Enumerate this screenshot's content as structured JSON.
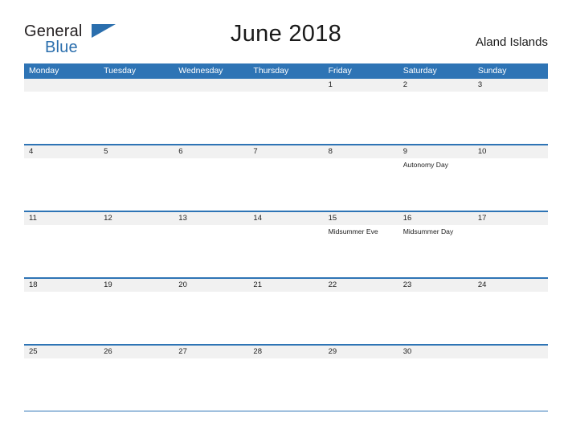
{
  "logo": {
    "text_general": "General",
    "text_blue": "Blue",
    "flag_icon": "blue-flag-icon"
  },
  "header": {
    "title": "June 2018",
    "region": "Aland Islands"
  },
  "colors": {
    "header_blue": "#2e74b5",
    "daynum_band": "#f1f1f1",
    "logo_blue": "#2a6ead",
    "text": "#222222"
  },
  "calendar": {
    "weekday_headers": [
      "Monday",
      "Tuesday",
      "Wednesday",
      "Thursday",
      "Friday",
      "Saturday",
      "Sunday"
    ],
    "weeks": [
      {
        "days": [
          {
            "num": "",
            "events": []
          },
          {
            "num": "",
            "events": []
          },
          {
            "num": "",
            "events": []
          },
          {
            "num": "",
            "events": []
          },
          {
            "num": "1",
            "events": []
          },
          {
            "num": "2",
            "events": []
          },
          {
            "num": "3",
            "events": []
          }
        ]
      },
      {
        "days": [
          {
            "num": "4",
            "events": []
          },
          {
            "num": "5",
            "events": []
          },
          {
            "num": "6",
            "events": []
          },
          {
            "num": "7",
            "events": []
          },
          {
            "num": "8",
            "events": []
          },
          {
            "num": "9",
            "events": [
              "Autonomy Day"
            ]
          },
          {
            "num": "10",
            "events": []
          }
        ]
      },
      {
        "days": [
          {
            "num": "11",
            "events": []
          },
          {
            "num": "12",
            "events": []
          },
          {
            "num": "13",
            "events": []
          },
          {
            "num": "14",
            "events": []
          },
          {
            "num": "15",
            "events": [
              "Midsummer Eve"
            ]
          },
          {
            "num": "16",
            "events": [
              "Midsummer Day"
            ]
          },
          {
            "num": "17",
            "events": []
          }
        ]
      },
      {
        "days": [
          {
            "num": "18",
            "events": []
          },
          {
            "num": "19",
            "events": []
          },
          {
            "num": "20",
            "events": []
          },
          {
            "num": "21",
            "events": []
          },
          {
            "num": "22",
            "events": []
          },
          {
            "num": "23",
            "events": []
          },
          {
            "num": "24",
            "events": []
          }
        ]
      },
      {
        "days": [
          {
            "num": "25",
            "events": []
          },
          {
            "num": "26",
            "events": []
          },
          {
            "num": "27",
            "events": []
          },
          {
            "num": "28",
            "events": []
          },
          {
            "num": "29",
            "events": []
          },
          {
            "num": "30",
            "events": []
          },
          {
            "num": "",
            "events": []
          }
        ]
      }
    ]
  }
}
